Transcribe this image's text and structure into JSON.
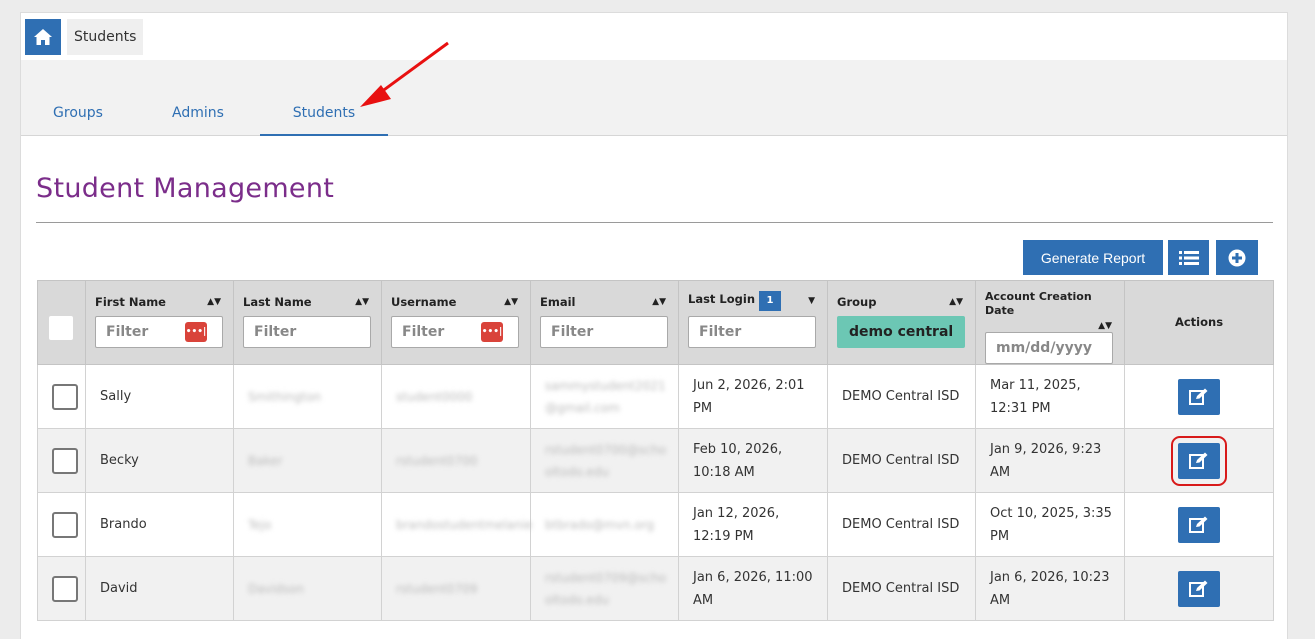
{
  "breadcrumb": {
    "current": "Students"
  },
  "tabs": [
    {
      "label": "Groups",
      "active": false
    },
    {
      "label": "Admins",
      "active": false
    },
    {
      "label": "Students",
      "active": true
    }
  ],
  "page": {
    "title": "Student Management"
  },
  "toolbar": {
    "generate_report_label": "Generate Report",
    "columns_icon": "list-icon",
    "add_icon": "plus-circle-icon"
  },
  "table": {
    "columns": {
      "first_name": "First Name",
      "last_name": "Last Name",
      "username": "Username",
      "email": "Email",
      "last_login": "Last Login",
      "last_login_sort_count": "1",
      "group": "Group",
      "account_created": "Account Creation Date",
      "actions": "Actions"
    },
    "filters": {
      "first_name_placeholder": "Filter",
      "last_name_placeholder": "Filter",
      "username_placeholder": "Filter",
      "email_placeholder": "Filter",
      "last_login_placeholder": "Filter",
      "group_value": "demo central",
      "account_created_placeholder": "mm/dd/yyyy"
    },
    "rows": [
      {
        "first_name": "Sally",
        "last_name": "Smithington",
        "username": "student0000",
        "email": "sammystudent2021@gmail.com",
        "last_login": "Jun 2, 2026, 2:01 PM",
        "group": "DEMO Central ISD",
        "created": "Mar 11, 2025, 12:31 PM"
      },
      {
        "first_name": "Becky",
        "last_name": "Baker",
        "username": "rstudent0700",
        "email": "rstudent0700@schooltodo.edu",
        "last_login": "Feb 10, 2026, 10:18 AM",
        "group": "DEMO Central ISD",
        "created": "Jan 9, 2026, 9:23 AM"
      },
      {
        "first_name": "Brando",
        "last_name": "Tejo",
        "username": "brandostudentmelanie",
        "email": "btbrado@mvn.org",
        "last_login": "Jan 12, 2026, 12:19 PM",
        "group": "DEMO Central ISD",
        "created": "Oct 10, 2025, 3:35 PM"
      },
      {
        "first_name": "David",
        "last_name": "Davidson",
        "username": "rstudent0709",
        "email": "rstudent0709@schooltodo.edu",
        "last_login": "Jan 6, 2026, 11:00 AM",
        "group": "DEMO Central ISD",
        "created": "Jan 6, 2026, 10:23 AM"
      }
    ]
  },
  "colors": {
    "accent": "#2f6fb3",
    "title": "#7b2d8a",
    "group_filter": "#6cc7b4",
    "highlight": "#d81a1a"
  }
}
